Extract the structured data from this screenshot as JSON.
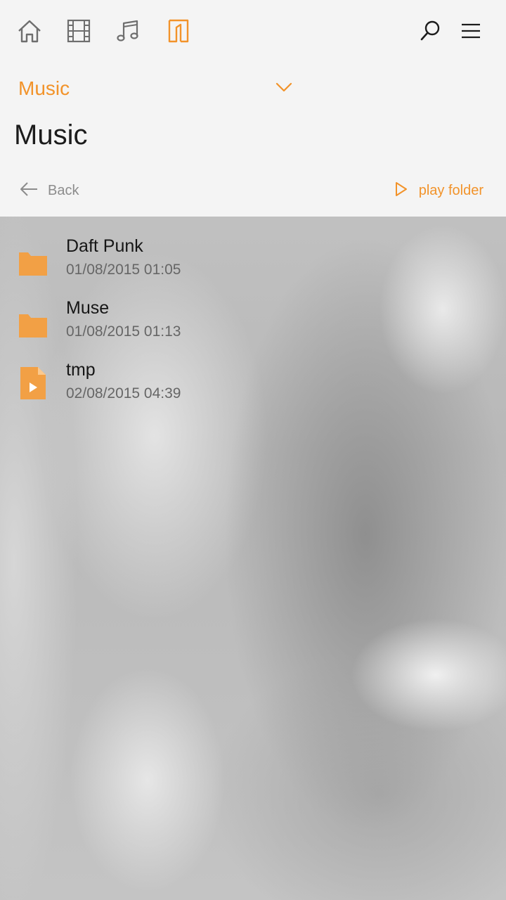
{
  "nav": {
    "items": [
      {
        "icon": "home-icon",
        "active": false
      },
      {
        "icon": "film-icon",
        "active": false
      },
      {
        "icon": "music-note-icon",
        "active": false
      },
      {
        "icon": "file-explorer-icon",
        "active": true
      }
    ],
    "search_icon": "search-icon",
    "menu_icon": "hamburger-menu-icon"
  },
  "picker": {
    "selected": "Music",
    "icon": "chevron-down-icon"
  },
  "page": {
    "title": "Music"
  },
  "actions": {
    "back_label": "Back",
    "play_folder_label": "play folder"
  },
  "items": [
    {
      "name": "Daft Punk",
      "date": "01/08/2015 01:05",
      "type": "folder",
      "icon": "folder-icon"
    },
    {
      "name": "Muse",
      "date": "01/08/2015 01:13",
      "type": "folder",
      "icon": "folder-icon"
    },
    {
      "name": "tmp",
      "date": "02/08/2015 04:39",
      "type": "video-file",
      "icon": "video-file-icon"
    }
  ],
  "colors": {
    "accent": "#f2932a",
    "icon_inactive": "#6e6e6e",
    "title_text": "#1c1c1c",
    "secondary_text": "#666666"
  }
}
